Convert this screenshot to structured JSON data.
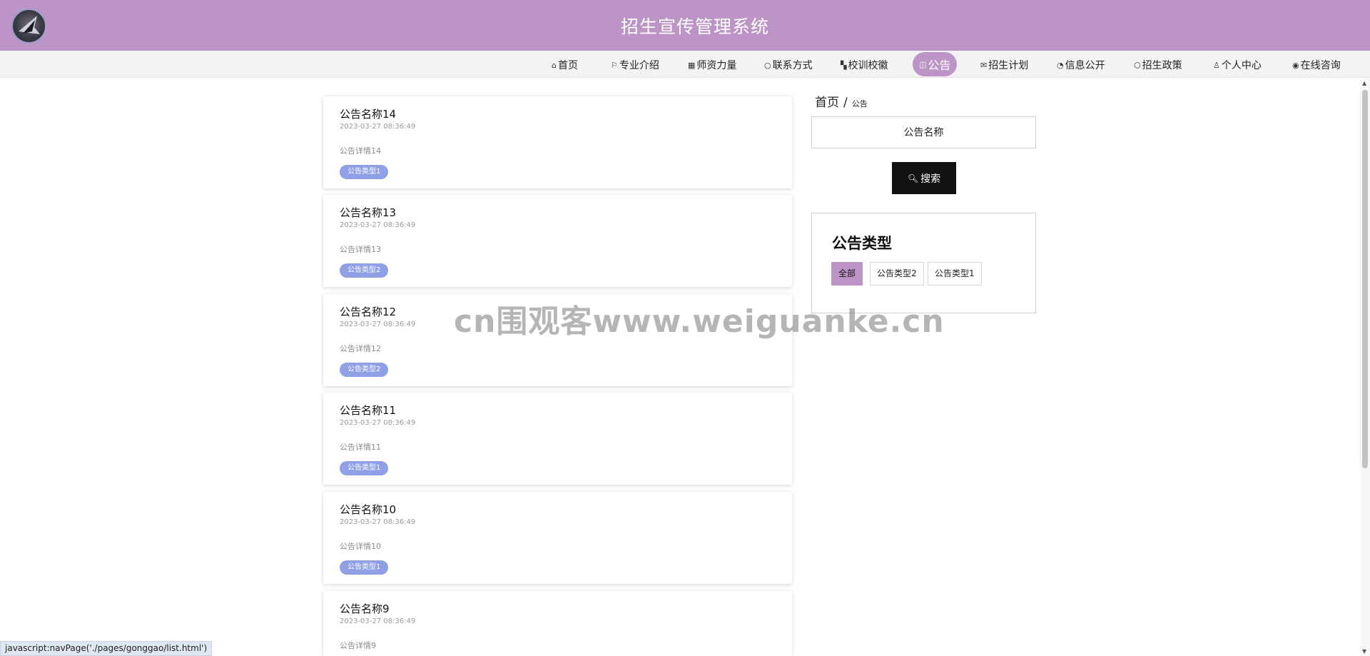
{
  "header": {
    "title": "招生宣传管理系统"
  },
  "nav": {
    "items": [
      {
        "icon": "⌂",
        "label": "首页"
      },
      {
        "icon": "⚐",
        "label": "专业介绍"
      },
      {
        "icon": "▦",
        "label": "师资力量"
      },
      {
        "icon": "○",
        "label": "联系方式"
      },
      {
        "icon": "▚",
        "label": "校训校徽"
      },
      {
        "icon": "◫",
        "label": "公告"
      },
      {
        "icon": "✉",
        "label": "招生计划"
      },
      {
        "icon": "◔",
        "label": "信息公开"
      },
      {
        "icon": "⬡",
        "label": "招生政策"
      },
      {
        "icon": "♙",
        "label": "个人中心"
      },
      {
        "icon": "◉",
        "label": "在线咨询"
      }
    ]
  },
  "cards": [
    {
      "title": "公告名称14",
      "date": "2023-03-27 08:36:49",
      "detail": "公告详情14",
      "tag": "公告类型1"
    },
    {
      "title": "公告名称13",
      "date": "2023-03-27 08:36:49",
      "detail": "公告详情13",
      "tag": "公告类型2"
    },
    {
      "title": "公告名称12",
      "date": "2023-03-27 08:36:49",
      "detail": "公告详情12",
      "tag": "公告类型2"
    },
    {
      "title": "公告名称11",
      "date": "2023-03-27 08:36:49",
      "detail": "公告详情11",
      "tag": "公告类型1"
    },
    {
      "title": "公告名称10",
      "date": "2023-03-27 08:36:49",
      "detail": "公告详情10",
      "tag": "公告类型1"
    },
    {
      "title": "公告名称9",
      "date": "2023-03-27 08:36:49",
      "detail": "公告详情9",
      "tag": ""
    }
  ],
  "breadcrumb": {
    "home": "首页",
    "sep": "/",
    "current": "公告"
  },
  "search": {
    "placeholder": "公告名称",
    "button_label": "搜索"
  },
  "types": {
    "title": "公告类型",
    "options": [
      "全部",
      "公告类型2",
      "公告类型1"
    ]
  },
  "watermark": "cn围观客www.weiguanke.cn",
  "statusbar": "javascript:navPage('./pages/gonggao/list.html')",
  "colors": {
    "header": "#bd94c6",
    "tag": "#8fa0e6",
    "search_button": "#111111"
  }
}
